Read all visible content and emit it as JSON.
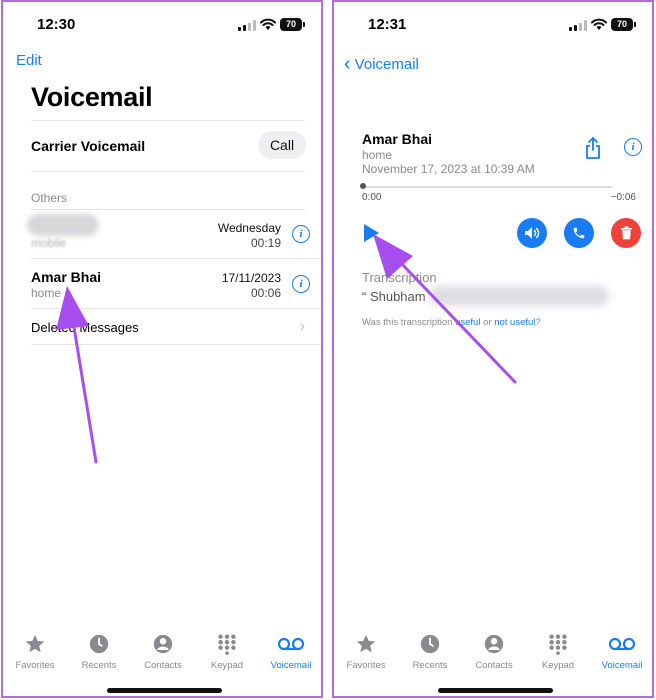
{
  "left": {
    "status_time": "12:30",
    "battery": "70",
    "edit": "Edit",
    "title": "Voicemail",
    "carrier_label": "Carrier Voicemail",
    "call_button": "Call",
    "others_header": "Others",
    "rows": [
      {
        "name": "",
        "sub": "mobile",
        "date": "Wednesday",
        "duration": "00:19"
      },
      {
        "name": "Amar Bhai",
        "sub": "home",
        "date": "17/11/2023",
        "duration": "00:06"
      }
    ],
    "deleted_messages": "Deleted Messages"
  },
  "right": {
    "status_time": "12:31",
    "battery": "70",
    "back": "Voicemail",
    "name": "Amar Bhai",
    "sub": "home",
    "date": "November 17, 2023 at 10:39 AM",
    "time_start": "0:00",
    "time_end": "−0:06",
    "transcription_title": "Transcription",
    "transcription_text": "“ Shubham",
    "feedback_prefix": "Was this transcription ",
    "feedback_useful": "useful",
    "feedback_or": " or ",
    "feedback_not_useful": "not useful",
    "feedback_suffix": "?"
  },
  "tabs": [
    {
      "label": "Favorites",
      "icon": "star-icon"
    },
    {
      "label": "Recents",
      "icon": "clock-icon"
    },
    {
      "label": "Contacts",
      "icon": "person-icon"
    },
    {
      "label": "Keypad",
      "icon": "keypad-icon"
    },
    {
      "label": "Voicemail",
      "icon": "voicemail-icon"
    }
  ],
  "colors": {
    "accent": "#1a7cf4",
    "delete": "#f0413a",
    "frame": "#b56be0",
    "annotation_arrow": "#a64ef0"
  }
}
